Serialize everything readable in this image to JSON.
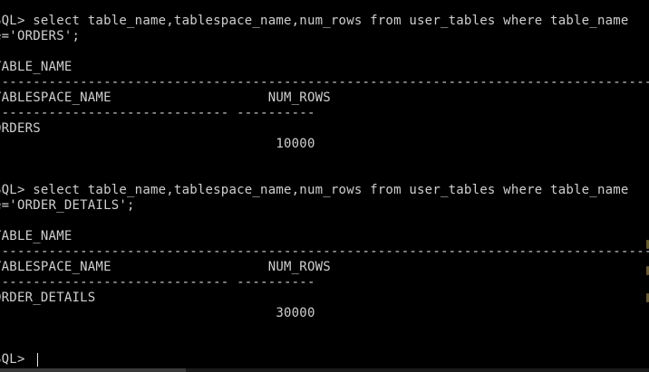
{
  "console": {
    "lines": [
      "SQL> select table_name,tablespace_name,num_rows from user_tables where table_name",
      "e='ORDERS';",
      "",
      "TABLE_NAME",
      "------------------------------------------------------------------------------------------",
      "TABLESPACE_NAME                    NUM_ROWS",
      "------------------------------ ----------",
      "ORDERS",
      "                                    10000",
      "",
      "",
      "SQL> select table_name,tablespace_name,num_rows from user_tables where table_name",
      "e='ORDER_DETAILS';",
      "",
      "TABLE_NAME",
      "------------------------------------------------------------------------------------------",
      "TABLESPACE_NAME                    NUM_ROWS",
      "------------------------------ ----------",
      "ORDER_DETAILS",
      "                                    30000",
      "",
      "",
      "SQL> "
    ]
  }
}
